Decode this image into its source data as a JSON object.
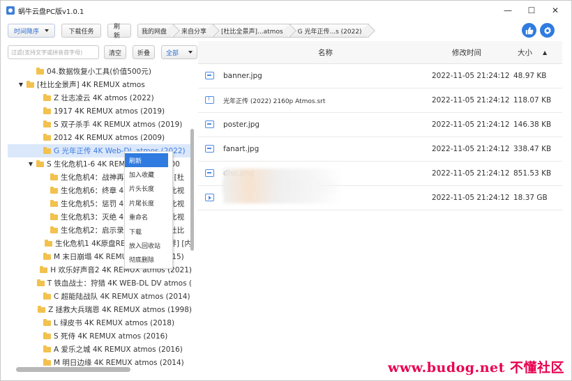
{
  "window": {
    "title": "蜗牛云盘PC版v1.0.1"
  },
  "win_controls": {
    "minimize": "—",
    "maximize": "☐",
    "close": "✕"
  },
  "toolbar": {
    "sort_label": "时间降序",
    "download_tasks": "下载任务",
    "refresh": "刷新",
    "breadcrumb": [
      "我的网盘",
      "来自分享",
      "[杜比全景声]...atmos",
      "G 光年正传...s (2022)"
    ]
  },
  "search": {
    "placeholder": "过滤(支持文字或拼音首字母)",
    "clear": "清空",
    "collapse": "折叠",
    "filter_select": "全部"
  },
  "tree": [
    {
      "indent": 1,
      "toggle": "",
      "label": "04.数据恢复小工具(价值500元)"
    },
    {
      "indent": 0,
      "toggle": "▼",
      "label": "[杜比全景声] 4K REMUX atmos"
    },
    {
      "indent": 2,
      "toggle": "",
      "label": "Z 壮志凌云 4K atmos (2022)"
    },
    {
      "indent": 2,
      "toggle": "",
      "label": "1917 4K REMUX atmos (2019)"
    },
    {
      "indent": 2,
      "toggle": "",
      "label": "S 双子杀手 4K REMUX atmos (2019)"
    },
    {
      "indent": 2,
      "toggle": "",
      "label": "2012 4K REMUX atmos  (2009)"
    },
    {
      "indent": 2,
      "toggle": "",
      "label": "G 光年正传 4K Web-DL atmos (2022)",
      "selected": true
    },
    {
      "indent": 1,
      "toggle": "▼",
      "label": "S 生化危机1-6 4K REMUX atmos (200"
    },
    {
      "indent": 3,
      "toggle": "",
      "label": "生化危机4：战神再生 4K REMUX [杜"
    },
    {
      "indent": 3,
      "toggle": "",
      "label": "生化危机6：终章 4K REMUX [杜比视"
    },
    {
      "indent": 3,
      "toggle": "",
      "label": "生化危机5：惩罚 4K REMUX [杜比视"
    },
    {
      "indent": 3,
      "toggle": "",
      "label": "生化危机3：灭绝 4K REMUX [杜比视"
    },
    {
      "indent": 3,
      "toggle": "",
      "label": "生化危机2：启示录 4K REMUX [杜比"
    },
    {
      "indent": 3,
      "toggle": "",
      "label": "生化危机1 4K原盘REMUX [杜比视界] [内"
    },
    {
      "indent": 2,
      "toggle": "",
      "label": "M 末日崩塌 4K REMUX atmos (2015)"
    },
    {
      "indent": 2,
      "toggle": "",
      "label": "H 欢乐好声音2 4K REMUX atmos (2021)"
    },
    {
      "indent": 2,
      "toggle": "",
      "label": "T 铁血战士：狩猎 4K WEB-DL DV atmos ("
    },
    {
      "indent": 2,
      "toggle": "",
      "label": "C 超能陆战队 4K REMUX atmos (2014)"
    },
    {
      "indent": 2,
      "toggle": "",
      "label": "Z 拯救大兵瑞恩 4K REMUX atmos  (1998)"
    },
    {
      "indent": 2,
      "toggle": "",
      "label": "L 绿皮书 4K REMUX atmos  (2018)"
    },
    {
      "indent": 2,
      "toggle": "",
      "label": "S 死侍 4K REMUX atmos (2016)"
    },
    {
      "indent": 2,
      "toggle": "",
      "label": "A 爱乐之城 4K REMUX atmos (2016)"
    },
    {
      "indent": 2,
      "toggle": "",
      "label": "M 明日边缘 4K REMUX atmos (2014)"
    }
  ],
  "context_menu": [
    "刷新",
    "加入收藏",
    "片头长度",
    "片尾长度",
    "重命名",
    "下载",
    "放入回收站",
    "彻底删除"
  ],
  "columns": {
    "name": "名称",
    "time": "修改时间",
    "size": "大小",
    "sort_indicator": "▲"
  },
  "files": [
    {
      "icon": "image-file-icon",
      "name": "banner.jpg",
      "time": "2022-11-05 21:24:12",
      "size": "48.97 KB"
    },
    {
      "icon": "text-file-icon",
      "name": "光年正传 (2022) 2160p Atmos.srt",
      "time": "2022-11-05 21:24:12",
      "size": "118.07 KB"
    },
    {
      "icon": "image-file-icon",
      "name": "poster.jpg",
      "time": "2022-11-05 21:24:12",
      "size": "146.38 KB"
    },
    {
      "icon": "image-file-icon",
      "name": "fanart.jpg",
      "time": "2022-11-05 21:24:12",
      "size": "338.47 KB"
    },
    {
      "icon": "image-file-icon",
      "name": "disc.png",
      "time": "2022-11-05 21:24:12",
      "size": "851.53 KB"
    },
    {
      "icon": "video-file-icon",
      "name": "",
      "time": "2022-11-05 21:24:12",
      "size": "18.37 GB"
    }
  ],
  "watermark": "www.budog.net 不懂社区"
}
